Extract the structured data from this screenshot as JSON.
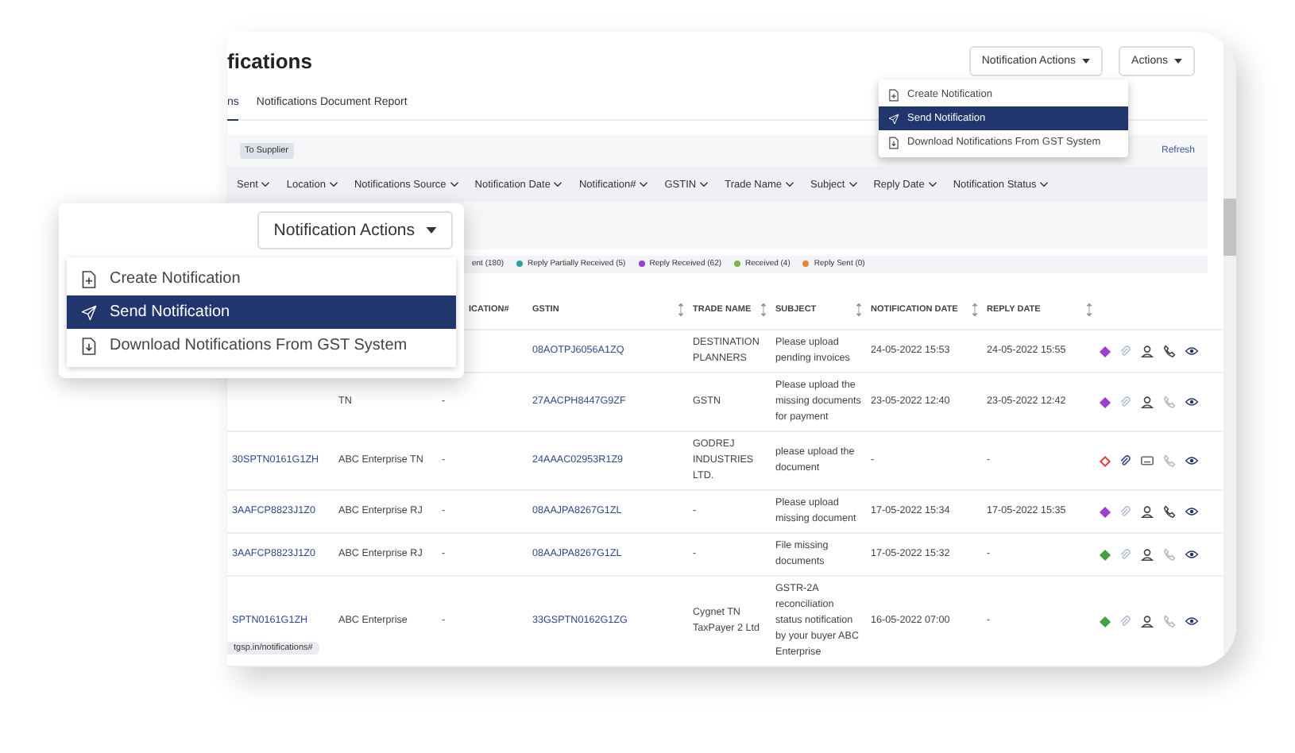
{
  "page": {
    "title": "fications",
    "buttons": {
      "notification_actions": "Notification Actions",
      "actions": "Actions"
    },
    "menu": [
      {
        "label": "Create Notification",
        "selected": false
      },
      {
        "label": "Send Notification",
        "selected": true
      },
      {
        "label": "Download Notifications From GST System",
        "selected": false
      }
    ],
    "tabs": [
      {
        "label": "ns",
        "selected": true
      },
      {
        "label": "Notifications Document Report",
        "selected": false
      }
    ],
    "chip": "To Supplier",
    "refresh": "Refresh",
    "filters": [
      "Sent",
      "Location",
      "Notifications Source",
      "Notification Date",
      "Notification#",
      "GSTIN",
      "Trade Name",
      "Subject",
      "Reply Date",
      "Notification Status"
    ],
    "legend": [
      {
        "label": "ent (180)"
      },
      {
        "label": "Reply Partially Received (5)",
        "color": "#26a69a"
      },
      {
        "label": "Reply Received (62)",
        "color": "#9b3fd0"
      },
      {
        "label": "Received (4)",
        "color": "#7cb342"
      },
      {
        "label": "Reply Sent (0)",
        "color": "#e08a2e"
      }
    ],
    "table": {
      "columns": [
        "ICATION#",
        "GSTIN",
        "TRADE NAME",
        "SUBJECT",
        "NOTIFICATION DATE",
        "REPLY DATE"
      ],
      "rows": [
        {
          "gstin": "08AOTPJ6056A1ZQ",
          "trade_name": "DESTINATION PLANNERS",
          "subject": "Please upload pending invoices",
          "notification_date": "24-05-2022 15:53",
          "reply_date": "24-05-2022 15:55",
          "status": {
            "color": "#9b3fd0",
            "kind": "filled"
          },
          "attachment_active": false,
          "reply_icon": {
            "kind": "person"
          },
          "call_active": true
        },
        {
          "location": "TN",
          "column_3": "-",
          "gstin": "27AACPH8447G9ZF",
          "trade_name": "GSTN",
          "subject": "Please upload the missing documents for payment",
          "notification_date": "23-05-2022 12:40",
          "reply_date": "23-05-2022 12:42",
          "status": {
            "color": "#9b3fd0",
            "kind": "filled"
          },
          "attachment_active": false,
          "reply_icon": {
            "kind": "person"
          },
          "call_active": false
        },
        {
          "column_1": "30SPTN0161G1ZH",
          "location": "ABC Enterprise TN",
          "column_3": "-",
          "gstin": "24AAAC02953R1Z9",
          "trade_name": "GODREJ INDUSTRIES LTD.",
          "subject": "please upload the document",
          "notification_date": "-",
          "reply_date": "-",
          "status": {
            "color": "#e53935",
            "kind": "outline"
          },
          "attachment_active": true,
          "reply_icon": {
            "kind": "message"
          },
          "call_active": false
        },
        {
          "column_1": "3AAFCP8823J1Z0",
          "location": "ABC Enterprise RJ",
          "column_3": "-",
          "gstin": "08AAJPA8267G1ZL",
          "trade_name": "-",
          "subject": "Please upload missing document",
          "notification_date": "17-05-2022 15:34",
          "reply_date": "17-05-2022 15:35",
          "status": {
            "color": "#9b3fd0",
            "kind": "filled"
          },
          "attachment_active": false,
          "reply_icon": {
            "kind": "person"
          },
          "call_active": true
        },
        {
          "column_1": "3AAFCP8823J1Z0",
          "location": "ABC Enterprise RJ",
          "column_3": "-",
          "gstin": "08AAJPA8267G1ZL",
          "trade_name": "-",
          "subject": "File missing documents",
          "notification_date": "17-05-2022 15:32",
          "reply_date": "-",
          "status": {
            "color": "#43a047",
            "kind": "filled"
          },
          "attachment_active": false,
          "reply_icon": {
            "kind": "person"
          },
          "call_active": false
        },
        {
          "column_1": "SPTN0161G1ZH",
          "location": "ABC Enterprise",
          "column_3": "-",
          "gstin": "33GSPTN0162G1ZG",
          "trade_name": "Cygnet TN TaxPayer 2 Ltd",
          "subject": "GSTR-2A reconciliation status notification by your buyer ABC Enterprise",
          "notification_date": "16-05-2022 07:00",
          "reply_date": "-",
          "status": {
            "color": "#43a047",
            "kind": "filled"
          },
          "attachment_active": false,
          "reply_icon": {
            "kind": "person"
          },
          "call_active": false
        }
      ]
    },
    "status_url": "tgsp.in/notifications#"
  },
  "callout": {
    "button": "Notification Actions",
    "menu": [
      {
        "label": "Create Notification",
        "selected": false
      },
      {
        "label": "Send Notification",
        "selected": true
      },
      {
        "label": "Download Notifications From GST System",
        "selected": false
      }
    ]
  }
}
